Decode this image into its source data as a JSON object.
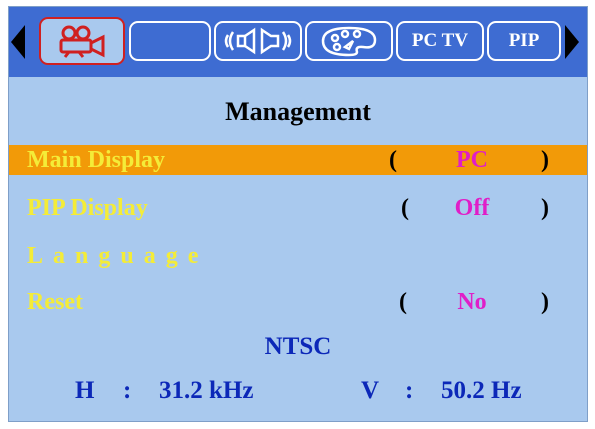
{
  "menu": {
    "tabs": [
      {
        "id": "video",
        "icon": "video-camera-icon",
        "label": ""
      },
      {
        "id": "blank",
        "icon": "",
        "label": ""
      },
      {
        "id": "audio",
        "icon": "speaker-icon",
        "label": ""
      },
      {
        "id": "color",
        "icon": "palette-icon",
        "label": ""
      },
      {
        "id": "pctv",
        "label": "PC TV"
      },
      {
        "id": "pip",
        "label": "PIP"
      }
    ],
    "active_tab": "video",
    "nav": {
      "left": "arrow-left-icon",
      "right": "arrow-right-icon"
    }
  },
  "page": {
    "title": "Management",
    "items": [
      {
        "label": "Main Display",
        "open": "(",
        "value": "PC",
        "close": ")",
        "selected": true
      },
      {
        "label": "PIP Display",
        "open": "(",
        "value": "Off",
        "close": ")",
        "selected": false
      },
      {
        "label": "Language",
        "selected": false
      },
      {
        "label": "Reset",
        "open": "(",
        "value": "No",
        "close": ")",
        "selected": false
      }
    ]
  },
  "signal": {
    "standard": "NTSC",
    "h_label": "H",
    "h_sep": ":",
    "h_value": "31.2 kHz",
    "v_label": "V",
    "v_sep": ":",
    "v_value": "50.2 Hz"
  },
  "colors": {
    "background": "#a9c9ee",
    "topbar": "#3e6cd2",
    "highlight": "#f29a08",
    "label": "#f4ec38",
    "value": "#e01ec8",
    "info": "#0c28b8"
  }
}
